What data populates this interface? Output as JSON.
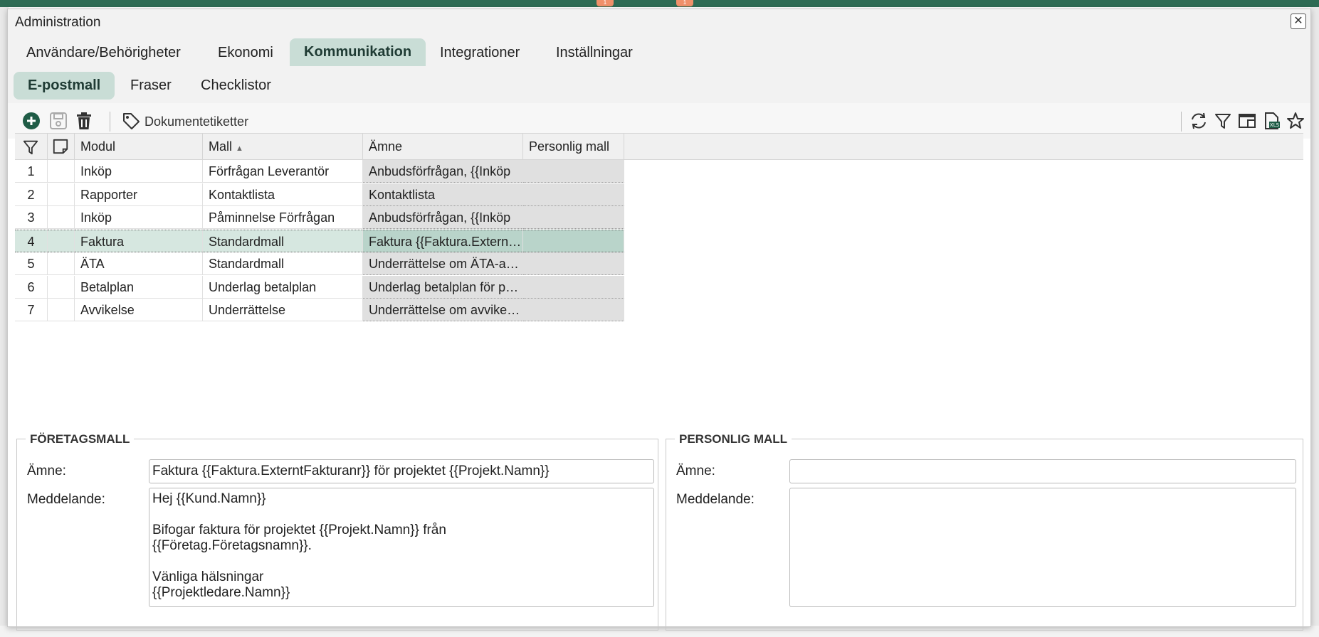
{
  "dialog": {
    "title": "Administration"
  },
  "main_tabs": [
    {
      "label": "Användare/Behörigheter"
    },
    {
      "label": "Ekonomi"
    },
    {
      "label": "Kommunikation"
    },
    {
      "label": "Integrationer"
    },
    {
      "label": "Inställningar"
    }
  ],
  "sub_tabs": [
    {
      "label": "E-postmall"
    },
    {
      "label": "Fraser"
    },
    {
      "label": "Checklistor"
    }
  ],
  "toolbar": {
    "document_tags_label": "Dokumentetiketter"
  },
  "grid": {
    "columns": {
      "module": "Modul",
      "template": "Mall",
      "subject": "Ämne",
      "personal": "Personlig mall"
    },
    "sort_indicator": "▲",
    "rows": [
      {
        "num": "1",
        "module": "Inköp",
        "template": "Förfrågan Leverantör",
        "subject": "Anbudsförfrågan, {{Inköp",
        "personal": ""
      },
      {
        "num": "2",
        "module": "Rapporter",
        "template": "Kontaktlista",
        "subject": "Kontaktlista",
        "personal": ""
      },
      {
        "num": "3",
        "module": "Inköp",
        "template": "Påminnelse Förfrågan",
        "subject": "Anbudsförfrågan, {{Inköp",
        "personal": ""
      },
      {
        "num": "4",
        "module": "Faktura",
        "template": "Standardmall",
        "subject": "Faktura {{Faktura.ExterntFakturanr",
        "personal": ""
      },
      {
        "num": "5",
        "module": "ÄTA",
        "template": "Standardmall",
        "subject": "Underrättelse om ÄTA-arbete",
        "personal": ""
      },
      {
        "num": "6",
        "module": "Betalplan",
        "template": "Underlag betalplan",
        "subject": "Underlag betalplan för projektet",
        "personal": ""
      },
      {
        "num": "7",
        "module": "Avvikelse",
        "template": "Underrättelse",
        "subject": "Underrättelse om avvikelse",
        "personal": ""
      }
    ]
  },
  "company_template": {
    "legend": "FÖRETAGSMALL",
    "subject_label": "Ämne:",
    "subject_value": "Faktura {{Faktura.ExterntFakturanr}} för projektet {{Projekt.Namn}}",
    "message_label": "Meddelande:",
    "message_value": "Hej {{Kund.Namn}}\n\nBifogar faktura för projektet {{Projekt.Namn}} från\n{{Företag.Företagsnamn}}.\n\nVänliga hälsningar\n{{Projektledare.Namn}}"
  },
  "personal_template": {
    "legend": "PERSONLIG MALL",
    "subject_label": "Ämne:",
    "subject_value": "",
    "message_label": "Meddelande:",
    "message_value": ""
  },
  "background_badges": [
    "1",
    "1"
  ],
  "colors": {
    "accent": "#c9ddd6",
    "header_bar": "#2e6b54",
    "selected_row": "#d6e7e0",
    "add_icon": "#1f5c46"
  }
}
